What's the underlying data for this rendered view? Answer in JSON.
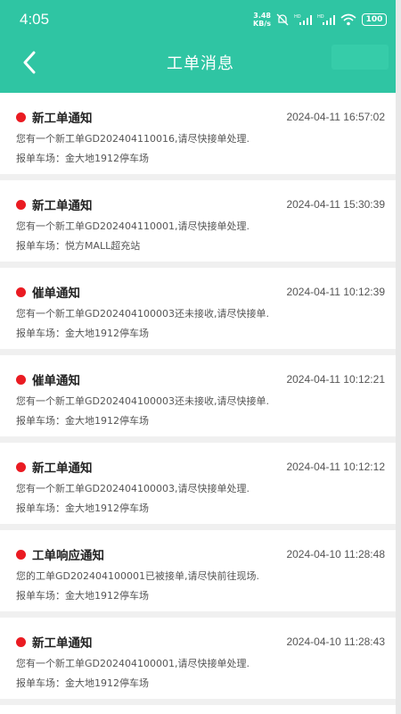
{
  "status": {
    "time": "4:05",
    "net_speed_top": "3.48",
    "net_speed_bottom": "KB/s",
    "battery": "100"
  },
  "nav": {
    "title": "工单消息"
  },
  "messages": [
    {
      "title": "新工单通知",
      "time": "2024-04-11 16:57:02",
      "body": "您有一个新工单GD202404110016,请尽快接单处理.",
      "lot": "报单车场：金大地1912停车场"
    },
    {
      "title": "新工单通知",
      "time": "2024-04-11 15:30:39",
      "body": "您有一个新工单GD202404110001,请尽快接单处理.",
      "lot": "报单车场：悦方MALL超充站"
    },
    {
      "title": "催单通知",
      "time": "2024-04-11 10:12:39",
      "body": "您有一个新工单GD202404100003还未接收,请尽快接单.",
      "lot": "报单车场：金大地1912停车场"
    },
    {
      "title": "催单通知",
      "time": "2024-04-11 10:12:21",
      "body": "您有一个新工单GD202404100003还未接收,请尽快接单.",
      "lot": "报单车场：金大地1912停车场"
    },
    {
      "title": "新工单通知",
      "time": "2024-04-11 10:12:12",
      "body": "您有一个新工单GD202404100003,请尽快接单处理.",
      "lot": "报单车场：金大地1912停车场"
    },
    {
      "title": "工单响应通知",
      "time": "2024-04-10 11:28:48",
      "body": "您的工单GD202404100001已被接单,请尽快前往现场.",
      "lot": "报单车场：金大地1912停车场"
    },
    {
      "title": "新工单通知",
      "time": "2024-04-10 11:28:43",
      "body": "您有一个新工单GD202404100001,请尽快接单处理.",
      "lot": "报单车场：金大地1912停车场"
    }
  ],
  "colors": {
    "header": "#2fc5a3",
    "unread_dot": "#ea1b22"
  }
}
